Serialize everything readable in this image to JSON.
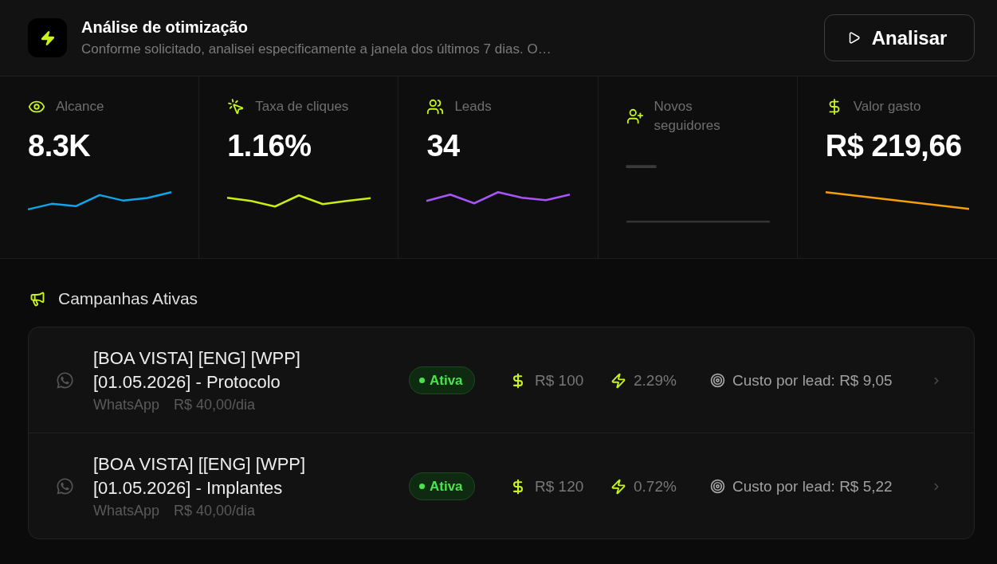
{
  "header": {
    "title": "Análise de otimização",
    "subtitle": "Conforme solicitado, analisei especificamente a janela dos últimos 7 dias. O…",
    "action_button": "Analisar"
  },
  "metrics": [
    {
      "kind": "reach",
      "label": "Alcance",
      "value": "8.3K",
      "no_data": false,
      "color": "#0ea5e9"
    },
    {
      "kind": "clicks",
      "label": "Taxa de cliques",
      "value": "1.16%",
      "no_data": false,
      "color": "#c8ee14"
    },
    {
      "kind": "leads",
      "label": "Leads",
      "value": "34",
      "no_data": false,
      "color": "#a855f7"
    },
    {
      "kind": "followers",
      "label": "Novos seguidores",
      "value": "—",
      "no_data": true,
      "color": "#333333"
    },
    {
      "kind": "spend",
      "label": "Valor gasto",
      "value": "R$ 219,66",
      "no_data": false,
      "color": "#f59e0b"
    }
  ],
  "campaigns_section": {
    "title": "Campanhas Ativas",
    "campaigns": [
      {
        "title": "[BOA VISTA] [ENG] [WPP] [01.05.2026] - Protocolo",
        "channel": "WhatsApp",
        "daily_budget": "R$ 40,00/dia",
        "status": {
          "label": "Ativa",
          "active": true
        },
        "budget": "R$ 100",
        "rate": "2.29%",
        "cost_per_lead": "Custo por lead: R$ 9,05"
      },
      {
        "title": "[BOA VISTA] [[ENG] [WPP] [01.05.2026] - Implantes",
        "channel": "WhatsApp",
        "daily_budget": "R$ 40,00/dia",
        "status": {
          "label": "Ativa",
          "active": true
        },
        "budget": "R$ 120",
        "rate": "0.72%",
        "cost_per_lead": "Custo por lead: R$ 5,22"
      }
    ]
  }
}
